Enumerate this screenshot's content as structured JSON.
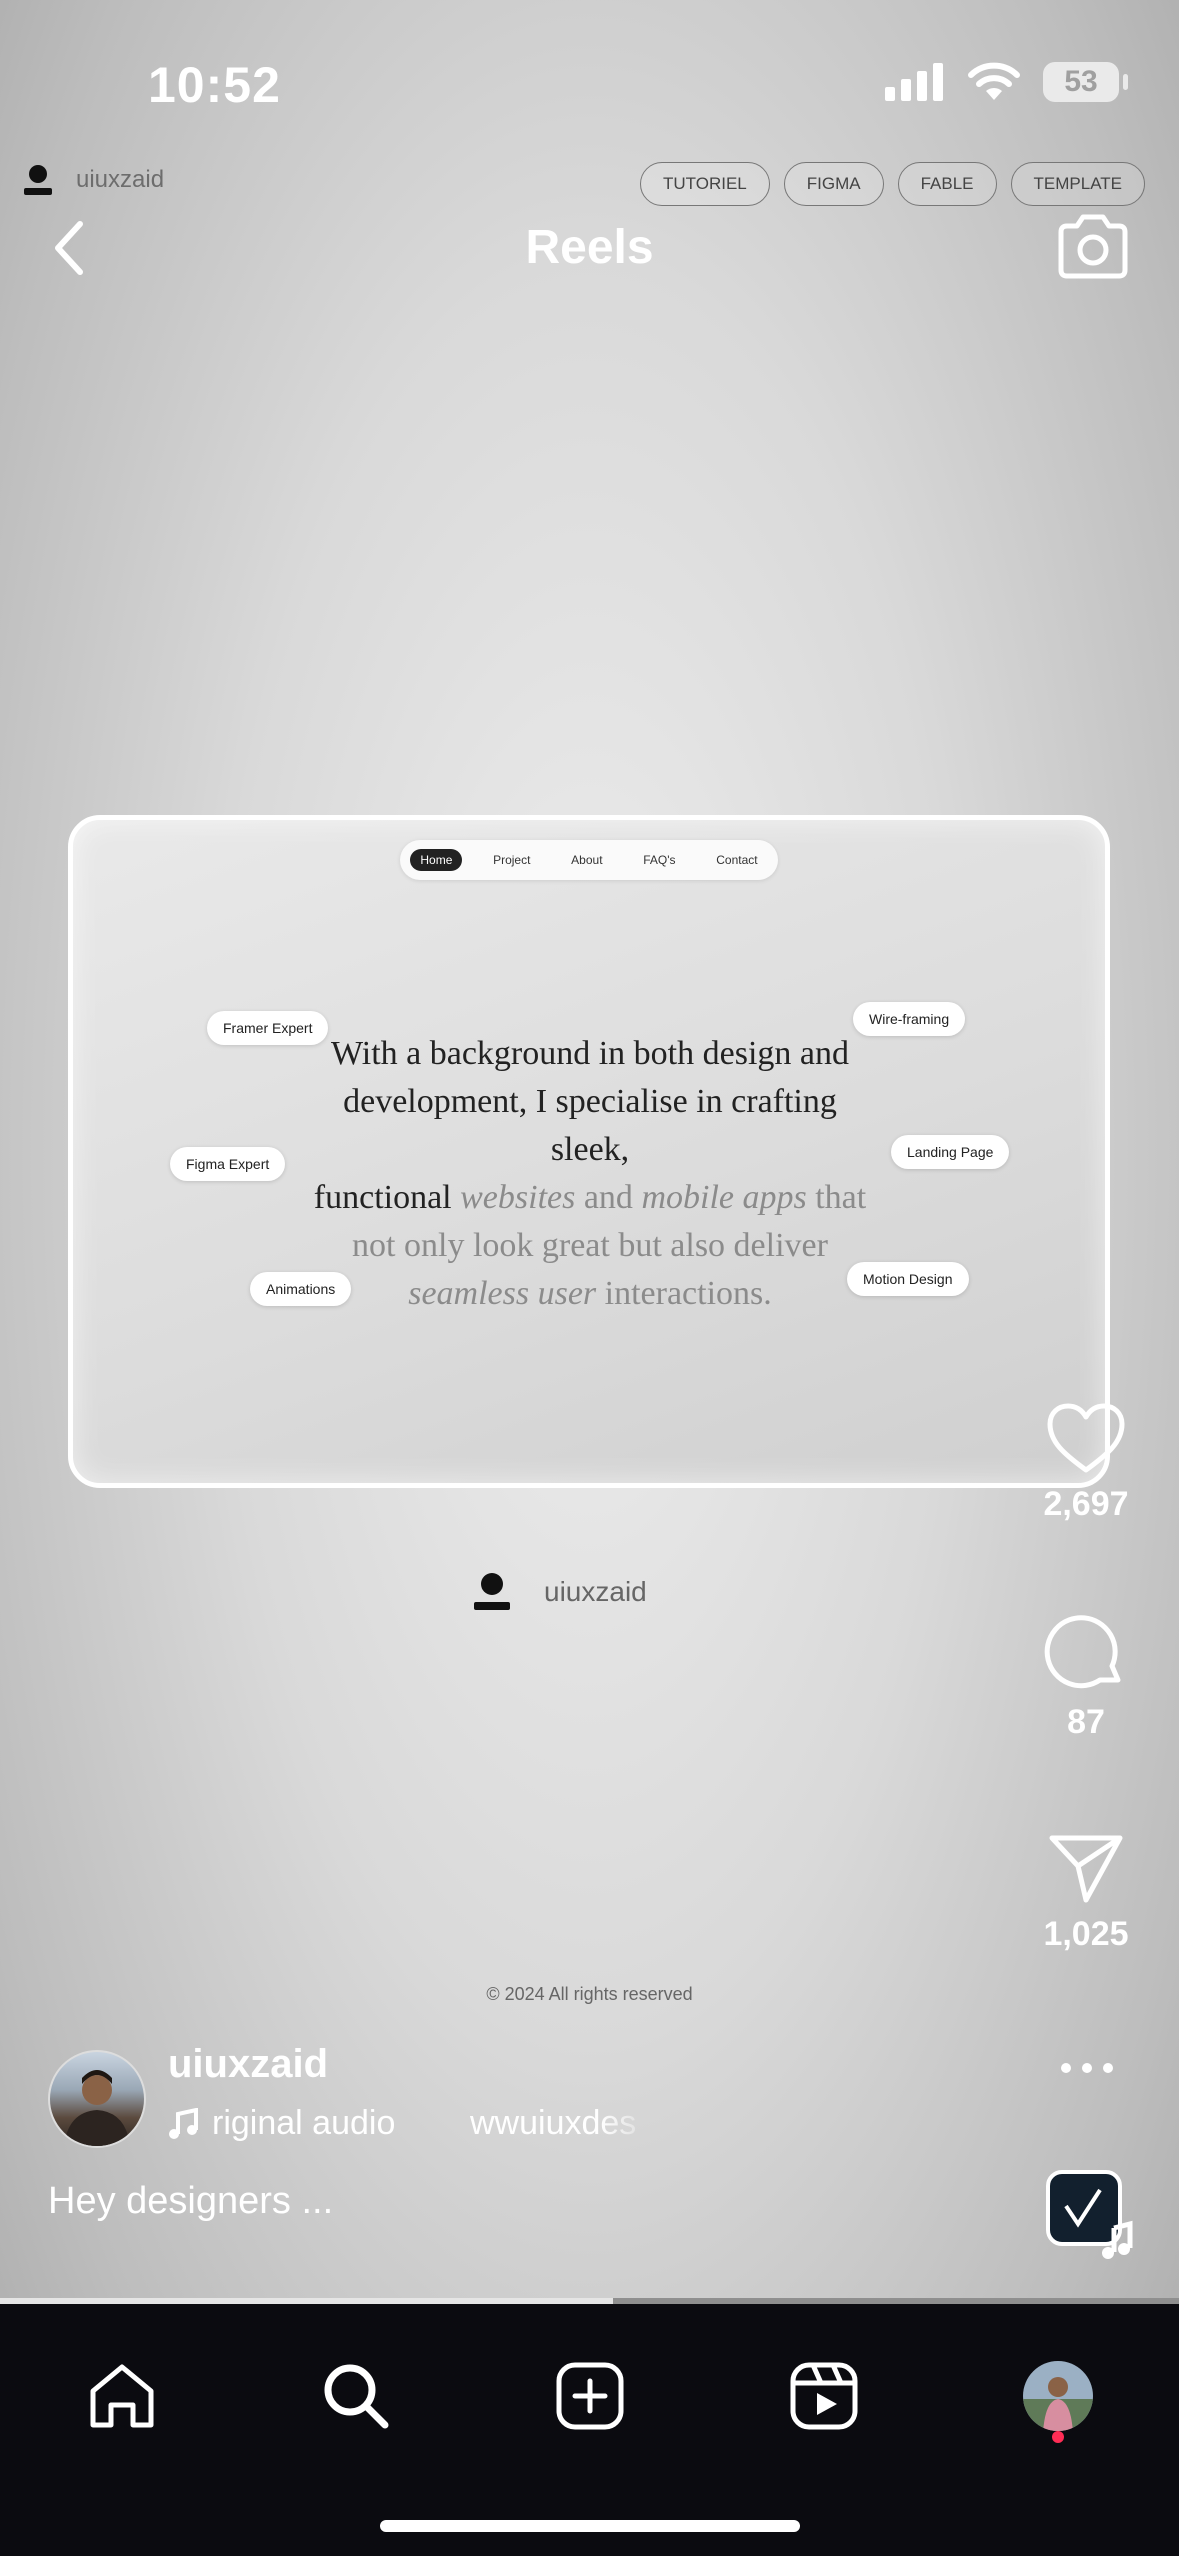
{
  "status_bar": {
    "time": "10:52",
    "battery": "53"
  },
  "watermark": {
    "username": "uiuxzaid"
  },
  "tags": [
    "TUTORIEL",
    "FIGMA",
    "FABLE",
    "TEMPLATE"
  ],
  "header": {
    "title": "Reels"
  },
  "website_preview": {
    "nav": [
      "Home",
      "Project",
      "About",
      "FAQ's",
      "Contact"
    ],
    "nav_active": "Home",
    "chips": [
      "Framer Expert",
      "Figma Expert",
      "Animations",
      "Wire-framing",
      "Landing Page",
      "Motion Design"
    ],
    "headline": {
      "line1": "With a background in both design and",
      "line2": "development, I specialise in crafting sleek,",
      "line3_a": "functional ",
      "line3_b": "websites",
      "line3_c": " and ",
      "line3_d": "mobile apps",
      "line3_e": " that",
      "line4": "not only look great but also deliver",
      "line5_a": "seamless user",
      "line5_b": " interactions."
    },
    "center_username": "uiuxzaid",
    "copyright": "© 2024 All rights reserved"
  },
  "actions": {
    "likes": "2,697",
    "comments": "87",
    "shares": "1,025"
  },
  "post": {
    "username": "uiuxzaid",
    "audio": "riginal audio",
    "audio_scroll": "wwuiuxdes",
    "caption": "Hey designers ..."
  },
  "progress": 0.52,
  "colors": {
    "tabbar": "#0b0b10",
    "notification_dot": "#ff2d55"
  },
  "tabs": [
    "home-icon",
    "search-icon",
    "create-icon",
    "reels-icon",
    "profile-avatar"
  ]
}
